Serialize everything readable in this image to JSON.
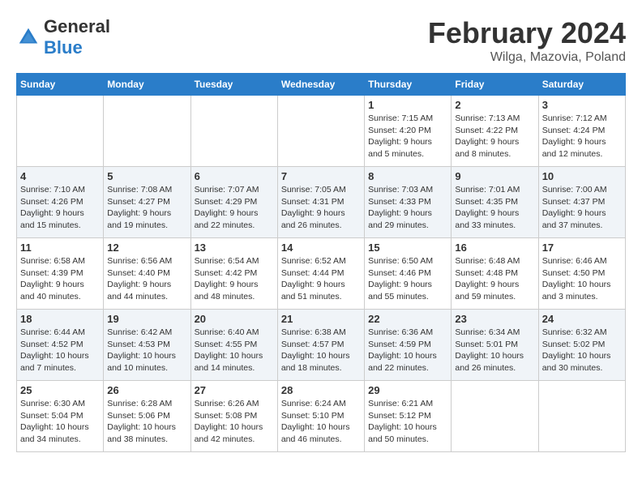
{
  "header": {
    "logo_general": "General",
    "logo_blue": "Blue",
    "title": "February 2024",
    "location": "Wilga, Mazovia, Poland"
  },
  "weekdays": [
    "Sunday",
    "Monday",
    "Tuesday",
    "Wednesday",
    "Thursday",
    "Friday",
    "Saturday"
  ],
  "weeks": [
    [
      {
        "day": "",
        "info": ""
      },
      {
        "day": "",
        "info": ""
      },
      {
        "day": "",
        "info": ""
      },
      {
        "day": "",
        "info": ""
      },
      {
        "day": "1",
        "info": "Sunrise: 7:15 AM\nSunset: 4:20 PM\nDaylight: 9 hours\nand 5 minutes."
      },
      {
        "day": "2",
        "info": "Sunrise: 7:13 AM\nSunset: 4:22 PM\nDaylight: 9 hours\nand 8 minutes."
      },
      {
        "day": "3",
        "info": "Sunrise: 7:12 AM\nSunset: 4:24 PM\nDaylight: 9 hours\nand 12 minutes."
      }
    ],
    [
      {
        "day": "4",
        "info": "Sunrise: 7:10 AM\nSunset: 4:26 PM\nDaylight: 9 hours\nand 15 minutes."
      },
      {
        "day": "5",
        "info": "Sunrise: 7:08 AM\nSunset: 4:27 PM\nDaylight: 9 hours\nand 19 minutes."
      },
      {
        "day": "6",
        "info": "Sunrise: 7:07 AM\nSunset: 4:29 PM\nDaylight: 9 hours\nand 22 minutes."
      },
      {
        "day": "7",
        "info": "Sunrise: 7:05 AM\nSunset: 4:31 PM\nDaylight: 9 hours\nand 26 minutes."
      },
      {
        "day": "8",
        "info": "Sunrise: 7:03 AM\nSunset: 4:33 PM\nDaylight: 9 hours\nand 29 minutes."
      },
      {
        "day": "9",
        "info": "Sunrise: 7:01 AM\nSunset: 4:35 PM\nDaylight: 9 hours\nand 33 minutes."
      },
      {
        "day": "10",
        "info": "Sunrise: 7:00 AM\nSunset: 4:37 PM\nDaylight: 9 hours\nand 37 minutes."
      }
    ],
    [
      {
        "day": "11",
        "info": "Sunrise: 6:58 AM\nSunset: 4:39 PM\nDaylight: 9 hours\nand 40 minutes."
      },
      {
        "day": "12",
        "info": "Sunrise: 6:56 AM\nSunset: 4:40 PM\nDaylight: 9 hours\nand 44 minutes."
      },
      {
        "day": "13",
        "info": "Sunrise: 6:54 AM\nSunset: 4:42 PM\nDaylight: 9 hours\nand 48 minutes."
      },
      {
        "day": "14",
        "info": "Sunrise: 6:52 AM\nSunset: 4:44 PM\nDaylight: 9 hours\nand 51 minutes."
      },
      {
        "day": "15",
        "info": "Sunrise: 6:50 AM\nSunset: 4:46 PM\nDaylight: 9 hours\nand 55 minutes."
      },
      {
        "day": "16",
        "info": "Sunrise: 6:48 AM\nSunset: 4:48 PM\nDaylight: 9 hours\nand 59 minutes."
      },
      {
        "day": "17",
        "info": "Sunrise: 6:46 AM\nSunset: 4:50 PM\nDaylight: 10 hours\nand 3 minutes."
      }
    ],
    [
      {
        "day": "18",
        "info": "Sunrise: 6:44 AM\nSunset: 4:52 PM\nDaylight: 10 hours\nand 7 minutes."
      },
      {
        "day": "19",
        "info": "Sunrise: 6:42 AM\nSunset: 4:53 PM\nDaylight: 10 hours\nand 10 minutes."
      },
      {
        "day": "20",
        "info": "Sunrise: 6:40 AM\nSunset: 4:55 PM\nDaylight: 10 hours\nand 14 minutes."
      },
      {
        "day": "21",
        "info": "Sunrise: 6:38 AM\nSunset: 4:57 PM\nDaylight: 10 hours\nand 18 minutes."
      },
      {
        "day": "22",
        "info": "Sunrise: 6:36 AM\nSunset: 4:59 PM\nDaylight: 10 hours\nand 22 minutes."
      },
      {
        "day": "23",
        "info": "Sunrise: 6:34 AM\nSunset: 5:01 PM\nDaylight: 10 hours\nand 26 minutes."
      },
      {
        "day": "24",
        "info": "Sunrise: 6:32 AM\nSunset: 5:02 PM\nDaylight: 10 hours\nand 30 minutes."
      }
    ],
    [
      {
        "day": "25",
        "info": "Sunrise: 6:30 AM\nSunset: 5:04 PM\nDaylight: 10 hours\nand 34 minutes."
      },
      {
        "day": "26",
        "info": "Sunrise: 6:28 AM\nSunset: 5:06 PM\nDaylight: 10 hours\nand 38 minutes."
      },
      {
        "day": "27",
        "info": "Sunrise: 6:26 AM\nSunset: 5:08 PM\nDaylight: 10 hours\nand 42 minutes."
      },
      {
        "day": "28",
        "info": "Sunrise: 6:24 AM\nSunset: 5:10 PM\nDaylight: 10 hours\nand 46 minutes."
      },
      {
        "day": "29",
        "info": "Sunrise: 6:21 AM\nSunset: 5:12 PM\nDaylight: 10 hours\nand 50 minutes."
      },
      {
        "day": "",
        "info": ""
      },
      {
        "day": "",
        "info": ""
      }
    ]
  ]
}
